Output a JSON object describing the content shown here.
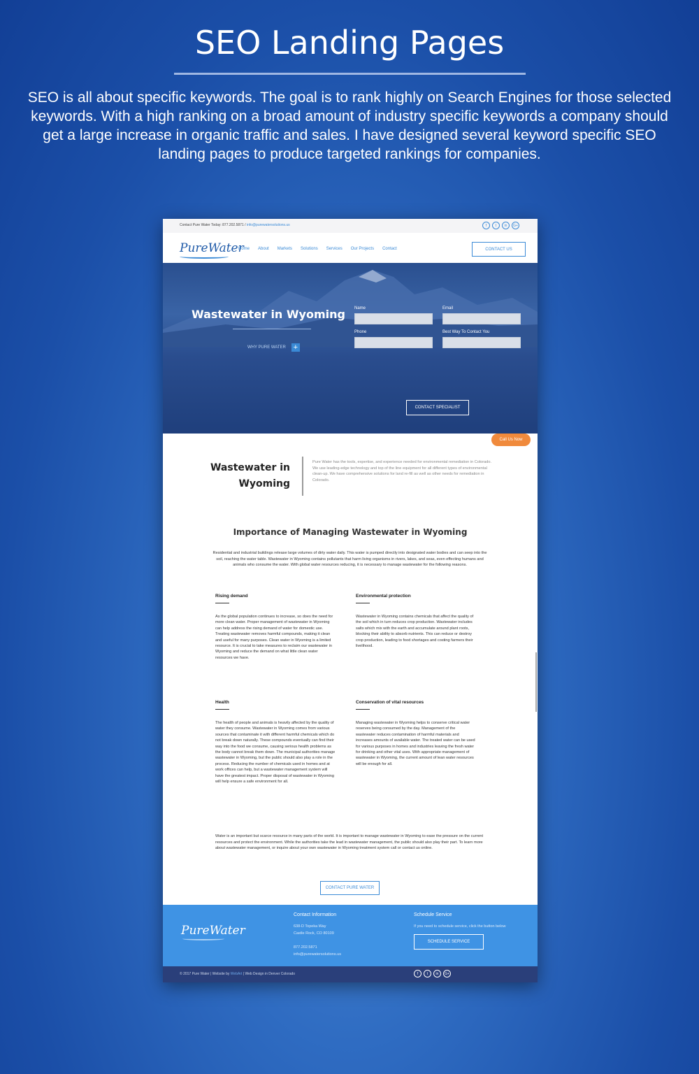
{
  "hero": {
    "title": "SEO Landing Pages",
    "description": "SEO is all about specific keywords. The goal is to rank highly on Search Engines for those selected keywords. With a high ranking on a broad amount of industry specific keywords a company should get a large increase in organic traffic and sales. I have designed several keyword specific SEO landing pages to produce targeted rankings for companies."
  },
  "site": {
    "topbar": {
      "contact_text": "Contact Pure Water Today: 877.202.5871 /",
      "email": "info@purewatersolutions.us",
      "social_icons": [
        "f",
        "t",
        "in",
        "G+"
      ]
    },
    "logo": "PureWater",
    "nav": [
      "Home",
      "About",
      "Markets",
      "Solutions",
      "Services",
      "Our Projects",
      "Contact"
    ],
    "contact_button": "CONTACT US",
    "banner": {
      "title": "Wastewater in Wyoming",
      "why_label": "WHY PURE WATER",
      "plus": "+",
      "form": {
        "name_label": "Name",
        "email_label": "Email",
        "phone_label": "Phone",
        "best_way_label": "Best Way To Contact You",
        "submit": "CONTACT SPECIALIST"
      }
    },
    "call_button": "Call Us Now",
    "intro": {
      "title_line1": "Wastewater in",
      "title_line2": "Wyoming",
      "text": "Pure Water has the tools, expertise, and experience needed for environmental remediation in Colorado. We use leading-edge technology and top of the line equipment for all different types of environmental clean-up. We have comprehensive solutions for land re-fill as well as other needs for remediation in Colorado."
    },
    "importance": {
      "title": "Importance of Managing Wastewater in Wyoming",
      "text": "Residential and industrial buildings release large volumes of dirty water daily. This water is pumped directly into designated water bodies and can seep into the soil, reaching the water table. Wastewater in Wyoming contains pollutants that harm living organisms in rivers, lakes, and seas, even effecting humans and animals who consume the water. With global water resources reducing, it is necessary to manage wastewater for the following reasons."
    },
    "features": [
      {
        "heading": "Rising demand",
        "body": "As the global population continues to increase, so does the need for more clean water. Proper management of wastewater in Wyoming can help address the rising demand of water for domestic use. Treating wastewater removes harmful compounds, making it clean and useful for many purposes. Clean water in Wyoming is a limited resource. It is crucial to take measures to reclaim our wastewater in Wyoming and reduce the demand on what little clean water resources we have."
      },
      {
        "heading": "Environmental protection",
        "body": "Wastewater in Wyoming contains chemicals that affect the quality of the soil which in turn reduces crop production. Wastewater includes salts which mix with the earth and accumulate around plant roots, blocking their ability to absorb nutrients. This can reduce or destroy crop production, leading to food shortages and costing farmers their livelihood."
      },
      {
        "heading": "Health",
        "body": "The health of people and animals is heavily affected by the quality of water they consume. Wastewater in Wyoming comes from various sources that contaminate it with different harmful chemicals which do not break down naturally. These compounds eventually can find their way into the food we consume, causing serious health problems as the body cannot break them down. The municipal authorities manage wastewater in Wyoming, but the public should also play a role in the process. Reducing the number of chemicals used in homes and at work offices can help, but a wastewater management system will have the greatest impact. Proper disposal of wastewater in Wyoming will help ensure a safe environment for all."
      },
      {
        "heading": "Conservation of vital resources",
        "body": "Managing wastewater in Wyoming helps to conserve critical water reserves being consumed by the day. Management of the wastewater reduces contamination of harmful materials and increases amounts of available water. The treated water can be used for various purposes in homes and industries leaving the fresh water for drinking and other vital uses. With appropriate management of wastewater in Wyoming, the current amount of lean water resources will be enough for all."
      }
    ],
    "closing": "Water is an important but scarce resource in many parts of the world. It is important to manage wastewater in Wyoming to ease the pressure on the current resources and protect the environment. While the authorities take the lead in wastewater management, the public should also play their part. To learn more about wastewater management, or inquire about your own wastewater in Wyoming treatment system call or contact us online.",
    "contact_pure_water_button": "CONTACT PURE WATER",
    "footer": {
      "logo": "PureWater",
      "contact_heading": "Contact Information",
      "address_line1": "638-D Topeka Way",
      "address_line2": "Castle Rock, CO 80109",
      "phone": "877.202.5871",
      "email": "info@purewatersolutions.us",
      "schedule_heading": "Schedule Service",
      "schedule_text": "If you need to schedule service, click the button below",
      "schedule_button": "SCHEDULE SERVICE",
      "copyright": "© 2017 Pure Water |  Website by",
      "credit_link": "WebArt",
      "credit_rest": "| Web Design in Denver Colorado"
    }
  }
}
